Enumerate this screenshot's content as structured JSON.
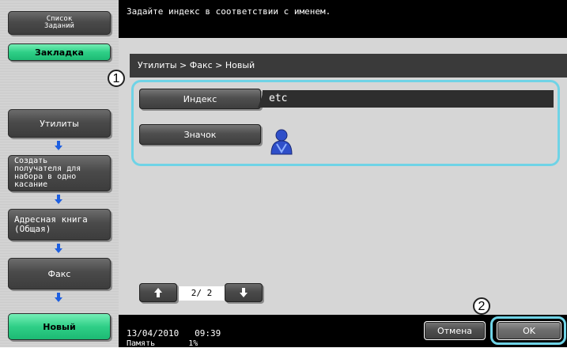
{
  "sidebar": {
    "job_list": "Список\nЗаданий",
    "bookmark": "Закладка",
    "steps": [
      {
        "label": "Утилиты"
      },
      {
        "label": "Создать\nполучателя для\nнабора в одно\nкасание"
      },
      {
        "label": "Адресная книга\n(Общая)"
      },
      {
        "label": "Факс"
      },
      {
        "label": "Новый"
      }
    ]
  },
  "message": "Задайте индекс в соответствии с именем.",
  "breadcrumb": "Утилиты > Факс > Новый",
  "fields": {
    "index_label": "Индекс",
    "index_value": "etc",
    "icon_label": "Значок"
  },
  "pager": {
    "text": "2/ 2"
  },
  "status": {
    "datetime": "13/04/2010   09:39",
    "memory": "Память       1%"
  },
  "buttons": {
    "cancel": "Отмена",
    "ok": "OK"
  },
  "callouts": [
    "1",
    "2"
  ],
  "colors": {
    "accent_green": "#2fcf87",
    "highlight": "#6fd3e6"
  },
  "icons": {
    "step_arrow": "arrow-down-icon",
    "user": "user-icon",
    "page_up": "arrow-up-icon",
    "page_down": "arrow-down-icon"
  }
}
